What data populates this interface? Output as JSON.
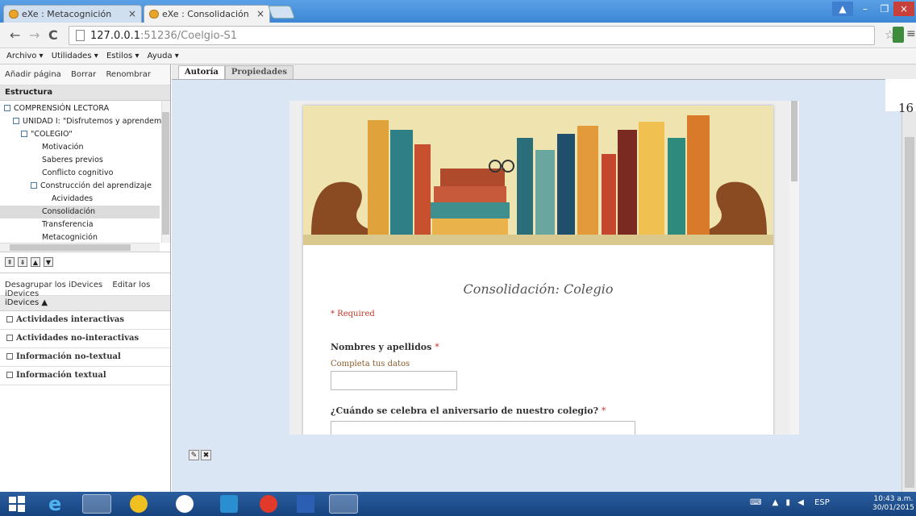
{
  "browser": {
    "tabs": [
      {
        "label": "eXe : Metacognición"
      },
      {
        "label": "eXe : Consolidación"
      }
    ],
    "url_host": "127.0.0.1",
    "url_port": ":51236",
    "url_path": "/Coelgio-S1"
  },
  "menu": {
    "items": [
      "Archivo ▾",
      "Utilidades ▾",
      "Estilos ▾",
      "Ayuda ▾"
    ]
  },
  "outline": {
    "toolbar": [
      "Añadir página",
      "Borrar",
      "Renombrar"
    ],
    "title": "Estructura",
    "nodes": [
      {
        "label": "COMPRENSIÓN LECTORA"
      },
      {
        "label": "UNIDAD I: \"Disfrutemos y aprendemos"
      },
      {
        "label": "\"COLEGIO\""
      },
      {
        "label": "Motivación"
      },
      {
        "label": "Saberes previos"
      },
      {
        "label": "Conflicto cognitivo"
      },
      {
        "label": "Construcción del aprendizaje"
      },
      {
        "label": "Acividades"
      },
      {
        "label": "Consolidación"
      },
      {
        "label": "Transferencia"
      },
      {
        "label": "Metacognición"
      }
    ]
  },
  "idevices": {
    "actions": [
      "Desagrupar los iDevices",
      "Editar los iDevices"
    ],
    "title": "iDevices ▲",
    "categories": [
      "Actividades interactivas",
      "Actividades no-interactivas",
      "Información no-textual",
      "Información textual"
    ]
  },
  "editor": {
    "tabs": [
      "Autoría",
      "Propiedades"
    ],
    "form": {
      "title": "Consolidación: Colegio",
      "required_note": "* Required",
      "q1": "Nombres y apellidos",
      "q1_hint": "Completa tus datos",
      "q2": "¿Cuándo se celebra el aniversario de nuestro colegio?",
      "asterisk": "*"
    },
    "clipped_text": "16"
  },
  "taskbar": {
    "tray_lang": "ESP",
    "time": "10:43 a.m.",
    "date": "30/01/2015"
  },
  "colors": {
    "accent": "#3c86d4",
    "required": "#c0392b",
    "hint": "#8b5a2b"
  }
}
